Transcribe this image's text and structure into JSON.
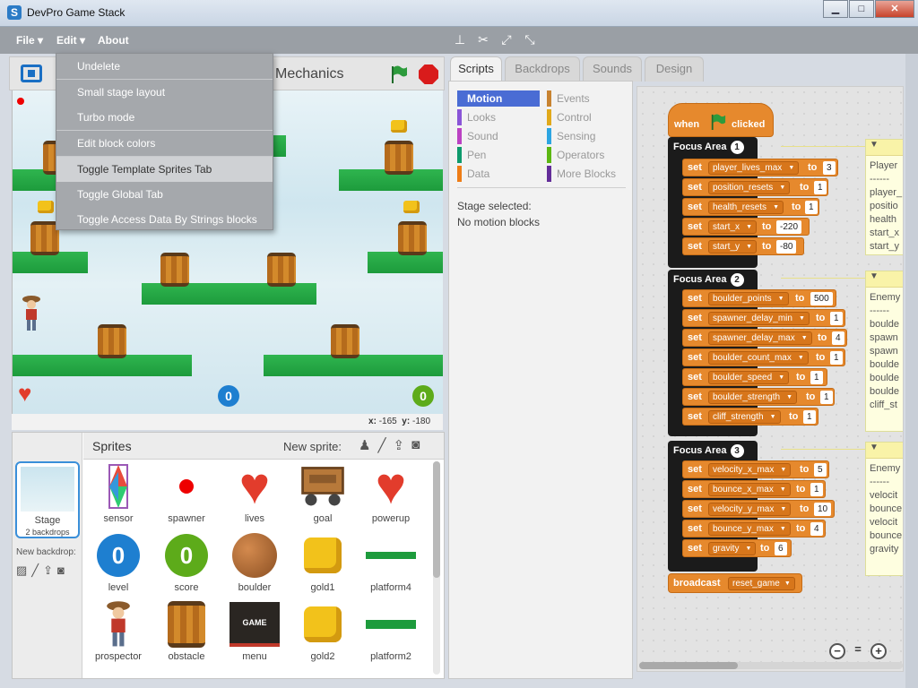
{
  "window": {
    "title": "DevPro Game Stack",
    "icon_letter": "S",
    "minimize": "▁",
    "maximize": "□",
    "close": "✕"
  },
  "menubar": {
    "file_label": "File ▾",
    "edit_label": "Edit ▾",
    "about_label": "About",
    "tool_icons": [
      "stamp-icon",
      "cut-icon",
      "grow-icon",
      "shrink-icon"
    ]
  },
  "edit_menu": {
    "items": [
      "Undelete",
      "Small stage layout",
      "Turbo mode",
      "Edit block colors",
      "Toggle Template Sprites Tab",
      "Toggle Global Tab",
      "Toggle Access Data By Strings blocks"
    ],
    "highlighted_index": 4
  },
  "stage": {
    "title": "Mechanics",
    "coord_x_label": "x:",
    "coord_x": "-165",
    "coord_y_label": "y:",
    "coord_y": "-180",
    "counter_left": "0",
    "counter_right": "0"
  },
  "sprites_panel": {
    "title": "Sprites",
    "new_sprite_label": "New sprite:",
    "stage_label": "Stage",
    "stage_sub": "2 backdrops",
    "new_backdrop_label": "New backdrop:",
    "sprites": [
      {
        "name": "sensor"
      },
      {
        "name": "spawner"
      },
      {
        "name": "lives"
      },
      {
        "name": "goal"
      },
      {
        "name": "powerup"
      },
      {
        "name": "level"
      },
      {
        "name": "score"
      },
      {
        "name": "boulder"
      },
      {
        "name": "gold1"
      },
      {
        "name": "platform4"
      },
      {
        "name": "prospector"
      },
      {
        "name": "obstacle"
      },
      {
        "name": "menu"
      },
      {
        "name": "gold2"
      },
      {
        "name": "platform2"
      }
    ],
    "menu_thumb_text": "GAME OVER!"
  },
  "tabs": [
    "Scripts",
    "Backdrops",
    "Sounds",
    "Design"
  ],
  "palette": {
    "categories": [
      {
        "name": "Motion",
        "color": "#4a6cd4"
      },
      {
        "name": "Looks",
        "color": "#8a55d7"
      },
      {
        "name": "Sound",
        "color": "#bb42c3"
      },
      {
        "name": "Pen",
        "color": "#0e9a6c"
      },
      {
        "name": "Data",
        "color": "#ee7d16"
      },
      {
        "name": "Events",
        "color": "#c88330"
      },
      {
        "name": "Control",
        "color": "#e1a91a"
      },
      {
        "name": "Sensing",
        "color": "#2ca5e2"
      },
      {
        "name": "Operators",
        "color": "#5cb712"
      },
      {
        "name": "More Blocks",
        "color": "#632d99"
      }
    ],
    "note_line1": "Stage selected:",
    "note_line2": "No motion blocks"
  },
  "script": {
    "hat_when": "when",
    "hat_clicked": "clicked",
    "set_kw": "set",
    "to_kw": "to",
    "focus_label": "Focus Area",
    "areas": [
      {
        "num": "1",
        "sets": [
          {
            "var": "player_lives_max",
            "val": "3"
          },
          {
            "var": "position_resets",
            "val": "1"
          },
          {
            "var": "health_resets",
            "val": "1"
          },
          {
            "var": "start_x",
            "val": "-220"
          },
          {
            "var": "start_y",
            "val": "-80"
          }
        ],
        "comment": [
          "Player",
          "------",
          "player_",
          "positio",
          "health",
          "start_x",
          "start_y"
        ]
      },
      {
        "num": "2",
        "sets": [
          {
            "var": "boulder_points",
            "val": "500"
          },
          {
            "var": "spawner_delay_min",
            "val": "1"
          },
          {
            "var": "spawner_delay_max",
            "val": "4"
          },
          {
            "var": "boulder_count_max",
            "val": "1"
          },
          {
            "var": "boulder_speed",
            "val": "1"
          },
          {
            "var": "boulder_strength",
            "val": "1"
          },
          {
            "var": "cliff_strength",
            "val": "1"
          }
        ],
        "comment": [
          "Enemy",
          "------",
          "boulde",
          "spawn",
          "spawn",
          "boulde",
          "boulde",
          "boulde",
          "cliff_st"
        ]
      },
      {
        "num": "3",
        "sets": [
          {
            "var": "velocity_x_max",
            "val": "5"
          },
          {
            "var": "bounce_x_max",
            "val": "1"
          },
          {
            "var": "velocity_y_max",
            "val": "10"
          },
          {
            "var": "bounce_y_max",
            "val": "4"
          },
          {
            "var": "gravity",
            "val": "6"
          }
        ],
        "comment": [
          "Enemy",
          "------",
          "velocit",
          "bounce",
          "velocit",
          "bounce",
          "gravity"
        ]
      }
    ],
    "broadcast_kw": "broadcast",
    "broadcast_msg": "reset_game",
    "zoom_out": "−",
    "zoom_reset": "=",
    "zoom_in": "+"
  }
}
